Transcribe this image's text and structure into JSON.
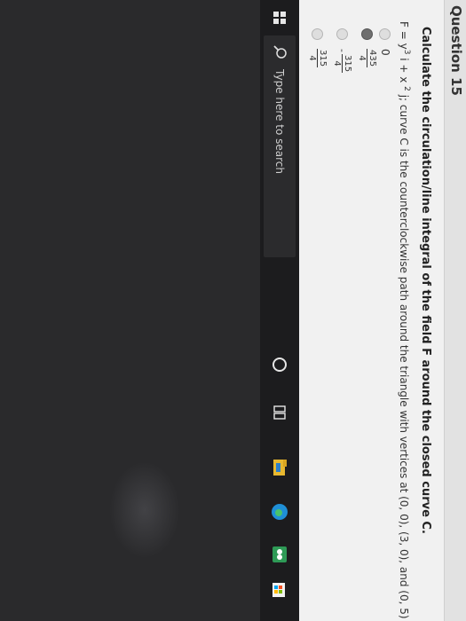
{
  "quiz": {
    "question_label": "Question 15",
    "question_text": "Calculate the circulation/line integral of the field F around the closed curve C.",
    "field": {
      "prefix": "F = y",
      "exp1": "3",
      "mid": " i + x ",
      "exp2": "2",
      "suffix": " j; curve C is the counterclockwise path around the triangle with vertices at (0, 0), (3, 0), and (0, 5)"
    },
    "choices": [
      {
        "label": "0",
        "selected": false
      },
      {
        "numerator": "435",
        "denominator": "4",
        "negative": false,
        "selected": true
      },
      {
        "numerator": "315",
        "denominator": "4",
        "negative": true,
        "selected": false
      },
      {
        "numerator": "315",
        "denominator": "4",
        "negative": false,
        "selected": false
      }
    ],
    "negative_sign": "-"
  },
  "taskbar": {
    "search_placeholder": "Type here to search",
    "icons": [
      "windows-start-icon",
      "search-icon",
      "cortana-icon",
      "task-view-icon",
      "file-explorer-icon",
      "edge-icon",
      "app-icon",
      "store-icon"
    ]
  },
  "colors": {
    "taskbar": "#1c1c1e",
    "quiz_bg": "#f1f1f1",
    "edge_blue": "#1f8fd6",
    "explorer_yellow": "#e8b830"
  }
}
